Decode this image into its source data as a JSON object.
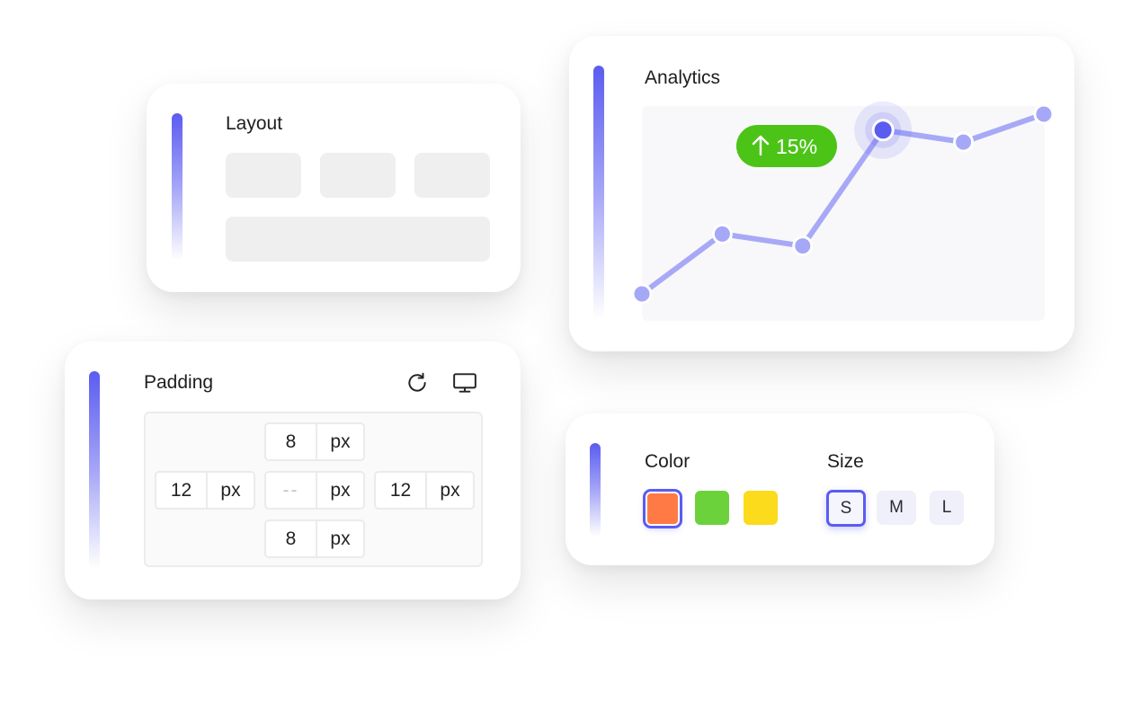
{
  "layout_card": {
    "title": "Layout"
  },
  "analytics_card": {
    "title": "Analytics",
    "badge": {
      "icon": "arrow-up-icon",
      "text": "15%"
    },
    "chart_data": {
      "type": "line",
      "series": [
        {
          "values": [
            1,
            2.5,
            2.2,
            5.1,
            4.8,
            5.5
          ]
        }
      ],
      "highlighted_index": 3,
      "colors": {
        "line": "#a7a9f7",
        "point": "#a5a7f7",
        "highlight": "#5b5cf0"
      }
    }
  },
  "padding_card": {
    "title": "Padding",
    "icons": {
      "reset": "refresh-icon",
      "device": "monitor-icon"
    },
    "top": {
      "value": "8",
      "unit": "px"
    },
    "left": {
      "value": "12",
      "unit": "px"
    },
    "center": {
      "value": "--",
      "unit": "px"
    },
    "right": {
      "value": "12",
      "unit": "px"
    },
    "bottom": {
      "value": "8",
      "unit": "px"
    }
  },
  "attributes_card": {
    "color_label": "Color",
    "size_label": "Size",
    "colors": [
      "#ff7a45",
      "#6cd23c",
      "#fbdb1b"
    ],
    "selected_color_index": 0,
    "sizes": [
      "S",
      "M",
      "L"
    ],
    "selected_size_index": 0
  },
  "theme": {
    "accent": "#5b5cf0",
    "badge_green": "#4cc417"
  }
}
